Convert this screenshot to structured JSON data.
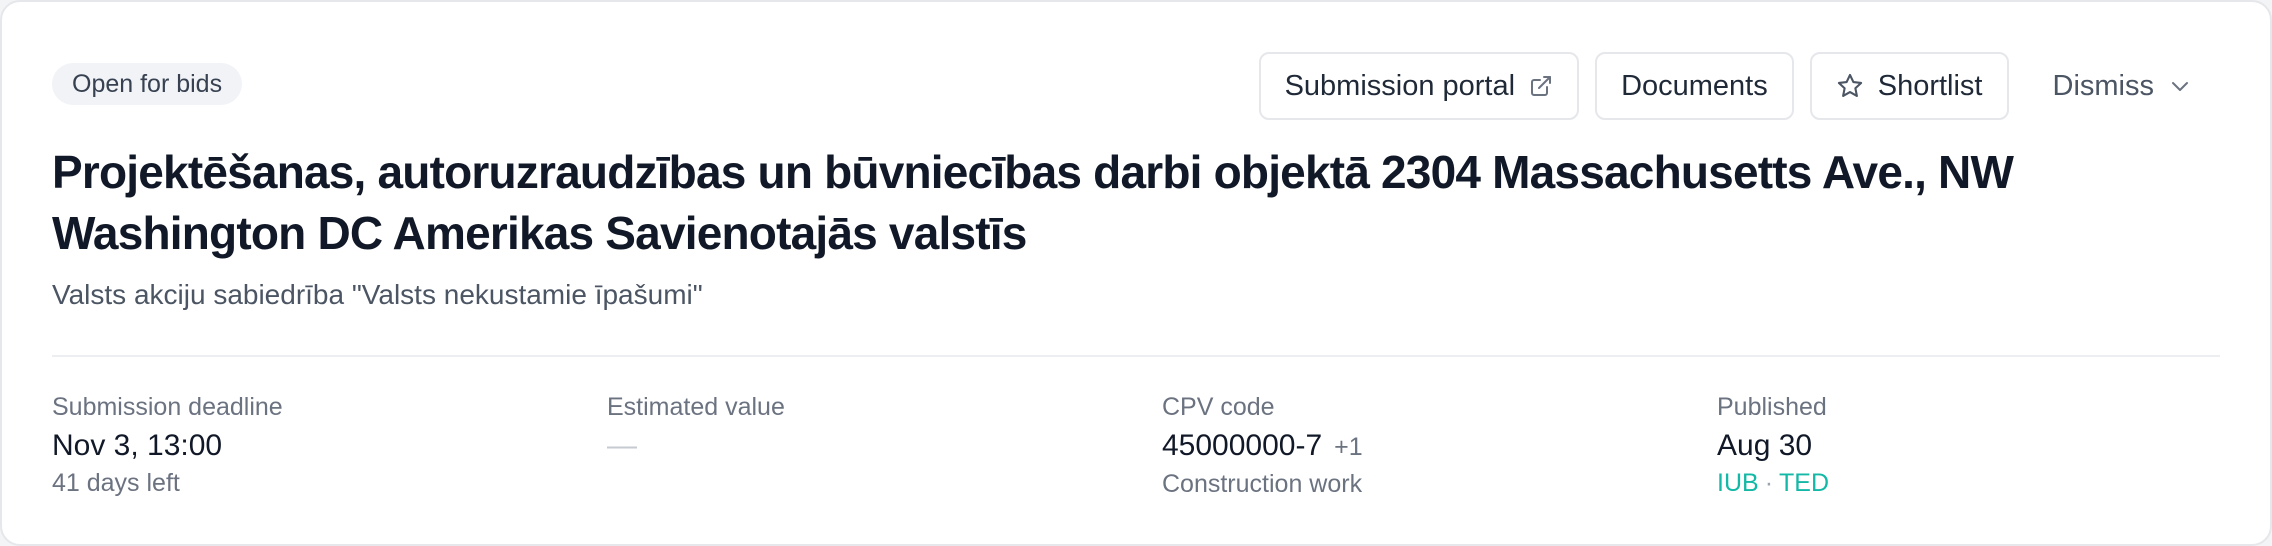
{
  "status_badge": "Open for bids",
  "actions": {
    "submission_portal": "Submission portal",
    "documents": "Documents",
    "shortlist": "Shortlist",
    "dismiss": "Dismiss"
  },
  "tender": {
    "title": "Projektēšanas, autoruzraudzības un būvniecības darbi objektā 2304 Massachusetts Ave., NW Washington DC Amerikas Savienotajās valstīs",
    "buyer": "Valsts akciju sabiedrība \"Valsts nekustamie īpašumi\""
  },
  "meta": {
    "deadline": {
      "label": "Submission deadline",
      "value": "Nov 3, 13:00",
      "sub": "41 days left"
    },
    "estimated": {
      "label": "Estimated value",
      "value": "—"
    },
    "cpv": {
      "label": "CPV code",
      "value": "45000000-7",
      "extra": "+1",
      "sub": "Construction work"
    },
    "published": {
      "label": "Published",
      "value": "Aug 30",
      "sources": [
        "IUB",
        "TED"
      ],
      "separator": "·"
    }
  },
  "colors": {
    "accent": "#14b8a6",
    "text": "#111827",
    "muted": "#6b7280",
    "border": "#e5e7eb"
  },
  "icons": {
    "submission_portal": "external-link-icon",
    "shortlist": "star-icon",
    "dismiss": "chevron-down-icon"
  }
}
